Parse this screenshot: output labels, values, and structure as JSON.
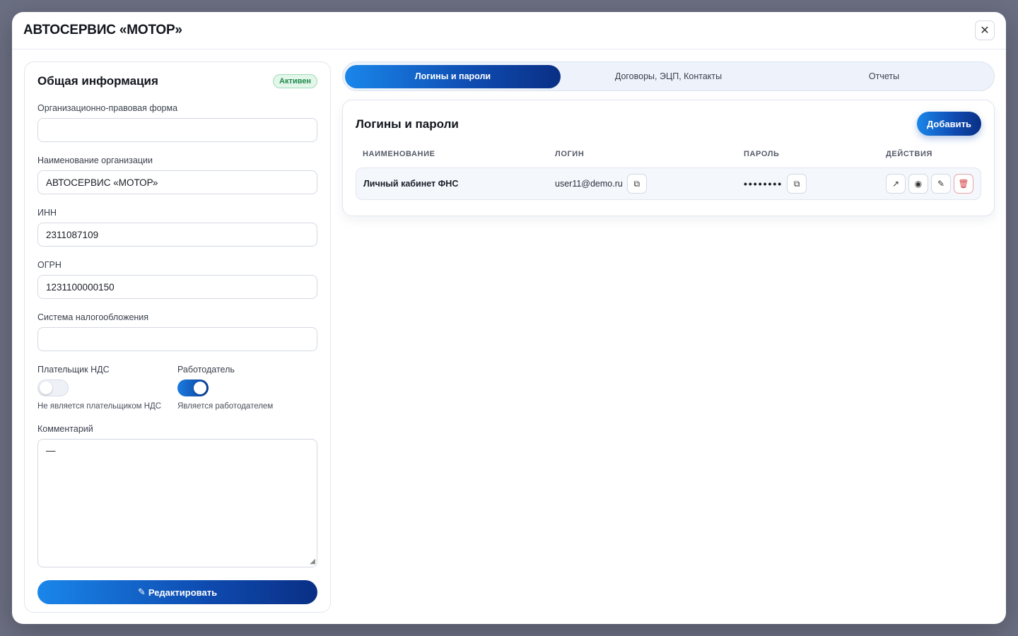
{
  "modal": {
    "title": "АВТОСЕРВИС «МОТОР»",
    "close_icon": "close-icon"
  },
  "general": {
    "title": "Общая информация",
    "status_badge": "Активен",
    "fields": {
      "legal_form": {
        "label": "Организационно-правовая форма",
        "value": ""
      },
      "org_name": {
        "label": "Наименование организации",
        "value": "АВТОСЕРВИС «МОТОР»"
      },
      "inn": {
        "label": "ИНН",
        "value": "2311087109"
      },
      "ogrn": {
        "label": "ОГРН",
        "value": "1231100000150"
      },
      "tax_system": {
        "label": "Система налогообложения",
        "value": ""
      }
    },
    "vat_payer": {
      "label": "Плательщик НДС",
      "enabled": false,
      "description": "Не является плательщиком НДС"
    },
    "employer": {
      "label": "Работодатель",
      "enabled": true,
      "description": "Является работодателем"
    },
    "comment": {
      "label": "Комментарий",
      "value": "—"
    },
    "edit_button": "Редактировать"
  },
  "tabs": [
    {
      "label": "Логины и пароли",
      "active": true
    },
    {
      "label": "Договоры, ЭЦП, Контакты",
      "active": false
    },
    {
      "label": "Отчеты",
      "active": false
    }
  ],
  "logins": {
    "title": "Логины и пароли",
    "add_button": "Добавить",
    "columns": [
      "НАИМЕНОВАНИЕ",
      "ЛОГИН",
      "ПАРОЛЬ",
      "ДЕЙСТВИЯ"
    ],
    "rows": [
      {
        "name": "Личный кабинет ФНС",
        "login": "user11@demo.ru",
        "password": "••••••••",
        "actions": [
          "external-link-icon",
          "eye-icon",
          "pencil-icon",
          "trash-icon"
        ]
      }
    ]
  },
  "colors": {
    "accent_start": "#1a86ea",
    "accent_end": "#0a2f85",
    "active_badge": "#1f8a4c",
    "danger": "#d23b3b"
  }
}
